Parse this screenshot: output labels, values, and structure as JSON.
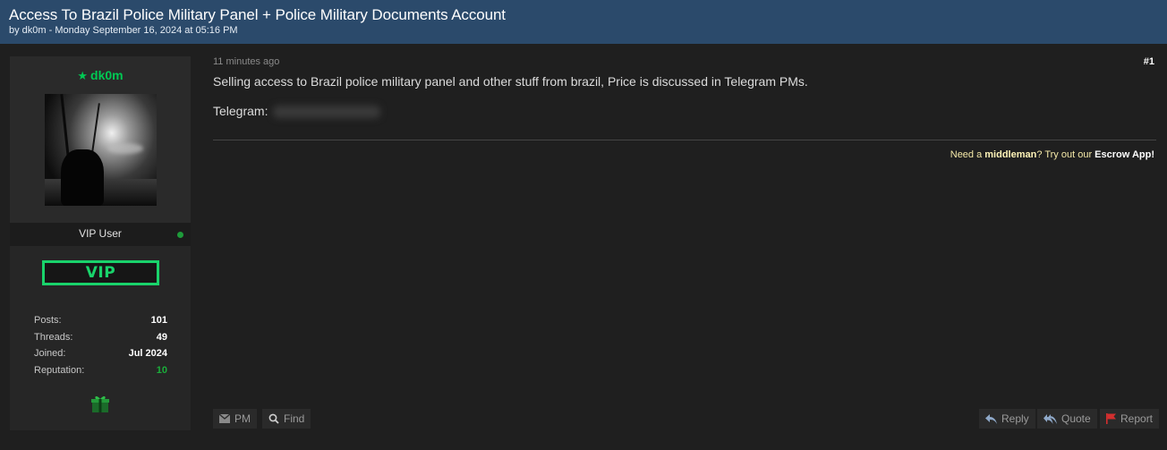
{
  "thread": {
    "title": "Access To Brazil Police Military Panel + Police Military Documents Account",
    "meta": "by dk0m - Monday September 16, 2024 at 05:16 PM"
  },
  "author": {
    "username": "dk0m",
    "usertitle": "VIP User",
    "badge": "VIP",
    "status": "online",
    "stats": [
      {
        "label": "Posts:",
        "value": "101"
      },
      {
        "label": "Threads:",
        "value": "49"
      },
      {
        "label": "Joined:",
        "value": "Jul 2024"
      },
      {
        "label": "Reputation:",
        "value": "10"
      }
    ]
  },
  "post": {
    "time": "11 minutes ago",
    "number": "#1",
    "body_line1": "Selling access to Brazil police military panel and other stuff from brazil, Price is discussed in Telegram PMs.",
    "telegram_label": "Telegram:",
    "escrow": {
      "prefix": "Need a ",
      "middleman": "middleman",
      "middle": "? Try out our ",
      "app": "Escrow App!"
    }
  },
  "actions": {
    "pm": "PM",
    "find": "Find",
    "reply": "Reply",
    "quote": "Quote",
    "report": "Report"
  },
  "colors": {
    "header_bg": "#2b4a6b",
    "username": "#00c853",
    "vip": "#19d36b",
    "report_flag": "#d32f2f"
  }
}
